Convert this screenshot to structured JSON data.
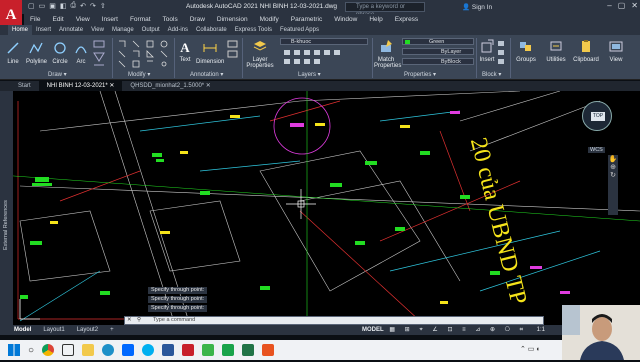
{
  "app": {
    "title": "Autodesk AutoCAD 2021   NHI BINH 12-03-2021.dwg",
    "search_placeholder": "Type a keyword or phrase",
    "signin_label": "Sign In",
    "logo_letter": "A"
  },
  "menubar": [
    "File",
    "Edit",
    "View",
    "Insert",
    "Format",
    "Tools",
    "Draw",
    "Dimension",
    "Modify",
    "Parametric",
    "Window",
    "Help",
    "Express"
  ],
  "ribbon_tabs": [
    "Home",
    "Insert",
    "Annotate",
    "View",
    "Manage",
    "Output",
    "Add-ins",
    "Collaborate",
    "Express Tools",
    "Featured Apps"
  ],
  "ribbon": {
    "draw_tools": [
      "Line",
      "Polyline",
      "Circle",
      "Arc"
    ],
    "draw_label": "Draw ▾",
    "modify_label": "Modify ▾",
    "annotation_tools": [
      "Text",
      "Dimension"
    ],
    "annotation_label": "Annotation ▾",
    "layer_props_label": "Layer\nProperties",
    "layer_name": "B-khuoc",
    "layers_label": "Layers ▾",
    "match_props_label": "Match\nProperties",
    "color_value": "Green",
    "linetype_value": "ByLayer",
    "lineweight_value": "ByBlock",
    "properties_label": "Properties ▾",
    "insert_label": "Insert",
    "block_label": "Block ▾",
    "groups_label": "Groups",
    "utilities_label": "Utilities",
    "clipboard_label": "Clipboard",
    "view_label": "View"
  },
  "doc_tabs": [
    "Start",
    "NHI BINH 12-03-2021*",
    "QHSDD_mionhat2_1.5000*"
  ],
  "side_palette_label": "External References",
  "drawing": {
    "vertical_text": "20 của UBND TP",
    "top_compass": "TOP",
    "wcs_label": "WCS"
  },
  "command_history": [
    "Specify through point:",
    "Specify through point:",
    "Specify through point:"
  ],
  "command_placeholder": "Type a command",
  "layout_tabs": [
    "Model",
    "Layout1",
    "Layout2",
    "+"
  ],
  "status": {
    "model_label": "MODEL",
    "scale": "1:1"
  },
  "colors": {
    "canvas": "#000000",
    "ribbon": "#3b4656",
    "accent_green": "#22dd22",
    "cad_yellow": "#f5e31a",
    "cad_magenta": "#e03ce0",
    "cad_cyan": "#2fc8e0"
  }
}
